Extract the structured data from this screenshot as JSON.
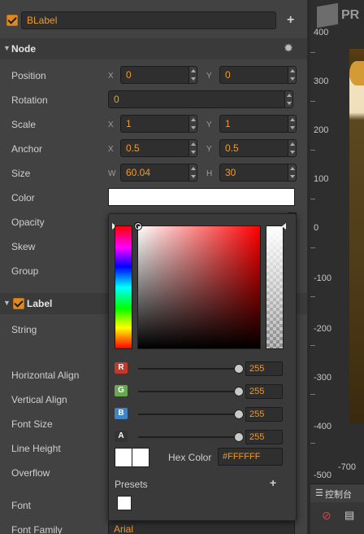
{
  "node_name": "BLabel",
  "node_section": {
    "title": "Node"
  },
  "properties": {
    "position": {
      "label": "Position",
      "x_axis": "X",
      "x": "0",
      "y_axis": "Y",
      "y": "0"
    },
    "rotation": {
      "label": "Rotation",
      "value": "0"
    },
    "scale": {
      "label": "Scale",
      "x_axis": "X",
      "x": "1",
      "y_axis": "Y",
      "y": "1"
    },
    "anchor": {
      "label": "Anchor",
      "x_axis": "X",
      "x": "0.5",
      "y_axis": "Y",
      "y": "0.5"
    },
    "size": {
      "label": "Size",
      "w_axis": "W",
      "w": "60.04",
      "h_axis": "H",
      "h": "30"
    },
    "color": {
      "label": "Color",
      "value": "#FFFFFF"
    },
    "opacity": {
      "label": "Opacity"
    },
    "skew": {
      "label": "Skew"
    },
    "group": {
      "label": "Group"
    }
  },
  "label_section": {
    "title": "Label",
    "items": {
      "string": "String",
      "horizontal_align": "Horizontal Align",
      "vertical_align": "Vertical Align",
      "font_size": "Font Size",
      "line_height": "Line Height",
      "overflow": "Overflow",
      "font": "Font",
      "font_family": "Font Family",
      "font_family_value": "Arial"
    }
  },
  "color_picker": {
    "channels": [
      {
        "badge": "R",
        "color": "#c0392b",
        "value": "255"
      },
      {
        "badge": "G",
        "color": "#6aa84f",
        "value": "255"
      },
      {
        "badge": "B",
        "color": "#3d85c6",
        "value": "255"
      },
      {
        "badge": "A",
        "color": "#333333",
        "value": "255"
      }
    ],
    "hex_label": "Hex Color",
    "hex_value": "#FFFFFF",
    "presets_label": "Presets",
    "presets_add": "+"
  },
  "scene": {
    "logo_text": "PR",
    "ruler": [
      "400",
      "300",
      "200",
      "100",
      "0",
      "-100",
      "-200",
      "-300",
      "-400",
      "-500"
    ],
    "bottom_ruler": "-700",
    "console_label": "控制台"
  },
  "colors": {
    "accent": "#f09a2c",
    "checkbox": "#e08a1e"
  }
}
